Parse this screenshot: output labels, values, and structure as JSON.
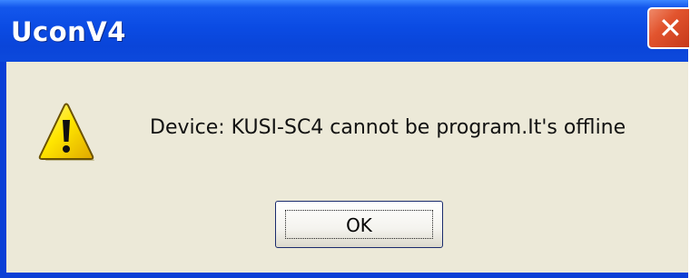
{
  "window": {
    "title": "UconV4",
    "close_icon": "close-icon"
  },
  "dialog": {
    "icon": "warning-icon",
    "message": "Device:  KUSI-SC4 cannot be program.It's offline",
    "ok_label": "OK"
  },
  "colors": {
    "title_bar": "#0a45d9",
    "close_button": "#e2542e",
    "client_bg": "#ece9d8",
    "warning_yellow": "#ffe600"
  }
}
